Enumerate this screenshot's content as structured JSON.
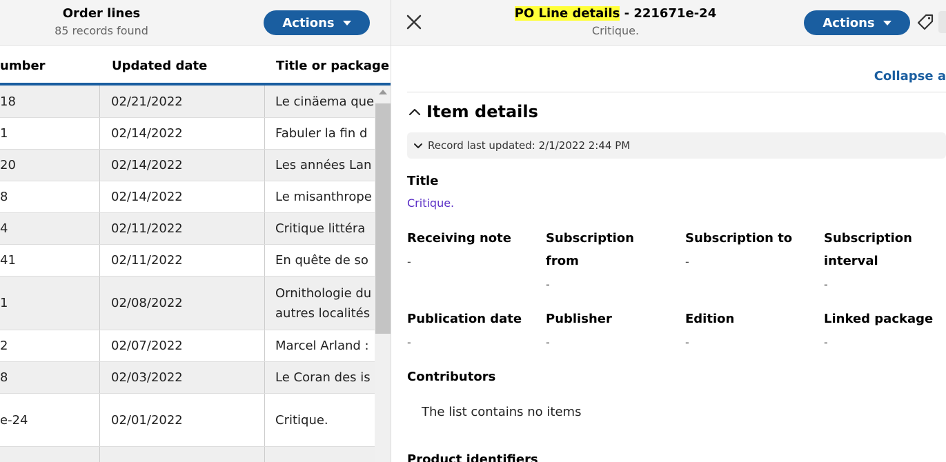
{
  "left": {
    "title": "Order lines",
    "subtitle": "85 records found",
    "actions_label": "Actions",
    "columns": [
      "umber",
      "Updated date",
      "Title or package"
    ],
    "rows": [
      {
        "num": "18",
        "date": "02/21/2022",
        "title": "Le cinäema que"
      },
      {
        "num": "1",
        "date": "02/14/2022",
        "title": "Fabuler la fin d"
      },
      {
        "num": "20",
        "date": "02/14/2022",
        "title": "Les années Lan"
      },
      {
        "num": "8",
        "date": "02/14/2022",
        "title": "Le misanthrope"
      },
      {
        "num": "4",
        "date": "02/11/2022",
        "title": "Critique littéra"
      },
      {
        "num": "41",
        "date": "02/11/2022",
        "title": "En quête de so"
      },
      {
        "num": "1",
        "date": "02/08/2022",
        "title": "Ornithologie du autres localités"
      },
      {
        "num": "2",
        "date": "02/07/2022",
        "title": "Marcel Arland :"
      },
      {
        "num": "8",
        "date": "02/03/2022",
        "title": "Le Coran des is"
      },
      {
        "num": "e-24",
        "date": "02/01/2022",
        "title": "Critique."
      },
      {
        "num": "",
        "date": "",
        "title": ""
      }
    ]
  },
  "right": {
    "title_highlight": "PO Line details",
    "title_rest": " - 221671e-24",
    "subtitle": "Critique.",
    "actions_label": "Actions",
    "collapse_all": "Collapse a",
    "section_title": "Item details",
    "record_updated": "Record last updated: 2/1/2022 2:44 PM",
    "title_label": "Title",
    "title_value": "Critique.",
    "fields": {
      "receiving_note": {
        "label": "Receiving note",
        "value": "-"
      },
      "subscription_from": {
        "label": "Subscription from",
        "value": "-"
      },
      "subscription_to": {
        "label": "Subscription to",
        "value": "-"
      },
      "subscription_interval": {
        "label": "Subscription interval",
        "value": "-"
      },
      "publication_date": {
        "label": "Publication date",
        "value": "-"
      },
      "publisher": {
        "label": "Publisher",
        "value": "-"
      },
      "edition": {
        "label": "Edition",
        "value": "-"
      },
      "linked_package": {
        "label": "Linked package",
        "value": "-"
      }
    },
    "contributors_label": "Contributors",
    "contributors_empty": "The list contains no items",
    "product_identifiers_label": "Product identifiers"
  },
  "colors": {
    "accent": "#1a5ea0",
    "highlight": "#ffff38",
    "link": "#5a2ec6"
  }
}
